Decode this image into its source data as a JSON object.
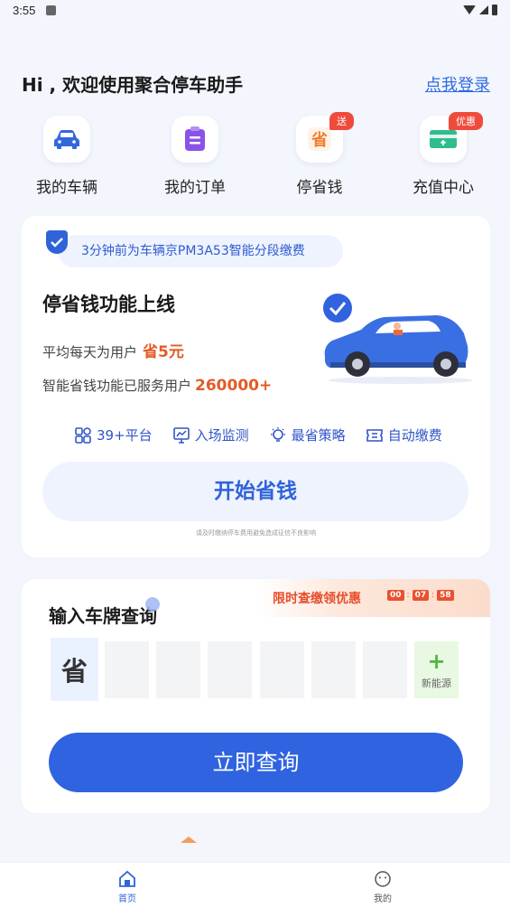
{
  "status": {
    "time": "3:55"
  },
  "header": {
    "greeting": "Hi , 欢迎使用聚合停车助手",
    "login": "点我登录"
  },
  "quick_actions": [
    {
      "label": "我的车辆",
      "icon": "car-icon",
      "badge": ""
    },
    {
      "label": "我的订单",
      "icon": "order-icon",
      "badge": ""
    },
    {
      "label": "停省钱",
      "icon": "save-money-icon",
      "badge": "送"
    },
    {
      "label": "充值中心",
      "icon": "recharge-card-icon",
      "badge": "优惠"
    }
  ],
  "promo_card": {
    "notice": "3分钟前为车辆京PM3A53智能分段缴费",
    "title": "停省钱功能上线",
    "avg_label": "平均每天为用户",
    "avg_value": "省5元",
    "served_label": "智能省钱功能已服务用户",
    "served_value": "260000+",
    "features": [
      "39+平台",
      "入场监测",
      "最省策略",
      "自动缴费"
    ],
    "start_button": "开始省钱",
    "disclaimer": "请及时缴纳停车费用避免造成征信不良影响"
  },
  "plate_query": {
    "title": "输入车牌查询",
    "promo": "限时查缴领优惠",
    "timer": [
      "00",
      "07",
      "58"
    ],
    "province": "省",
    "new_energy": "新能源",
    "query_button": "立即查询"
  },
  "tabbar": {
    "home": "首页",
    "mine": "我的"
  },
  "colors": {
    "accent": "#2f63e0",
    "highlight": "#e35b25",
    "badge": "#ef4b3d"
  }
}
